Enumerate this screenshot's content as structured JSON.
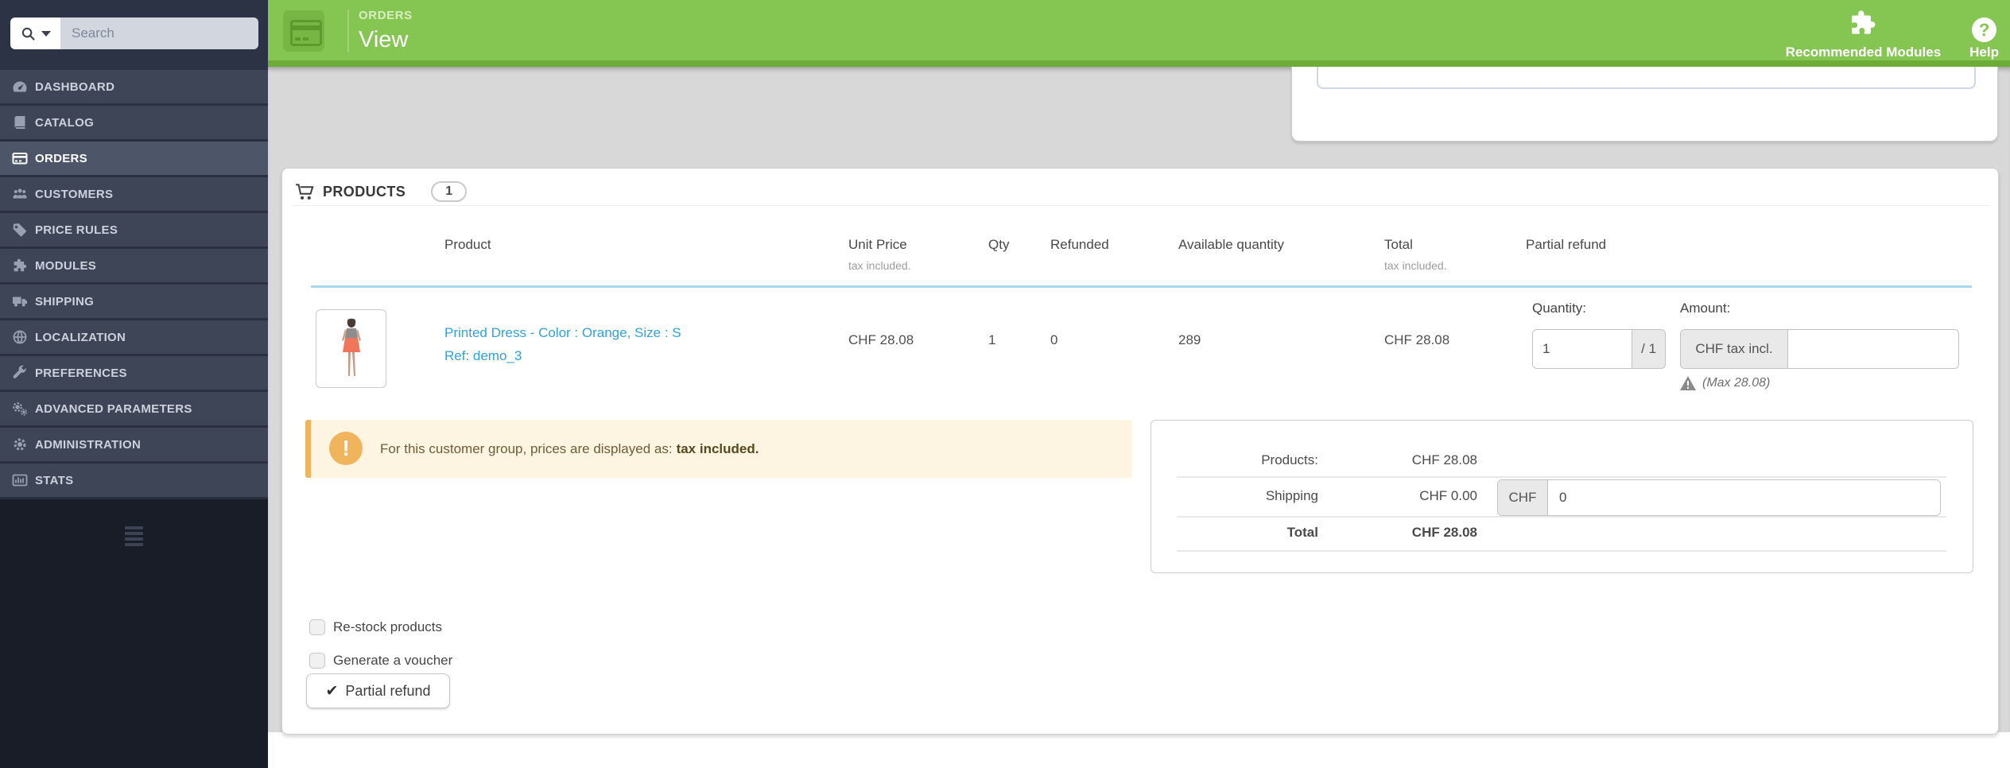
{
  "colors": {
    "accent_green": "#85c551",
    "link_blue": "#2fa3dc",
    "warning_orange": "#f0b45c"
  },
  "sidebar": {
    "search_placeholder": "Search",
    "items": [
      {
        "label": "DASHBOARD"
      },
      {
        "label": "CATALOG"
      },
      {
        "label": "ORDERS"
      },
      {
        "label": "CUSTOMERS"
      },
      {
        "label": "PRICE RULES"
      },
      {
        "label": "MODULES"
      },
      {
        "label": "SHIPPING"
      },
      {
        "label": "LOCALIZATION"
      },
      {
        "label": "PREFERENCES"
      },
      {
        "label": "ADVANCED PARAMETERS"
      },
      {
        "label": "ADMINISTRATION"
      },
      {
        "label": "STATS"
      }
    ]
  },
  "header": {
    "breadcrumb": "ORDERS",
    "title": "View",
    "recommended_modules_label": "Recommended Modules",
    "help_label": "Help",
    "help_glyph": "?"
  },
  "panel": {
    "title": "PRODUCTS",
    "count": "1",
    "columns": {
      "product": "Product",
      "unit_price": "Unit Price",
      "qty": "Qty",
      "refunded": "Refunded",
      "available_quantity": "Available quantity",
      "total": "Total",
      "partial_refund": "Partial refund",
      "tax_note": "tax included."
    },
    "row": {
      "name": "Printed Dress - Color : Orange, Size : S",
      "ref": "Ref: demo_3",
      "unit_price": "CHF 28.08",
      "qty": "1",
      "refunded": "0",
      "available_quantity": "289",
      "total": "CHF 28.08",
      "refund_quantity_label": "Quantity:",
      "refund_quantity_value": "1",
      "refund_quantity_max": "/ 1",
      "refund_amount_label": "Amount:",
      "refund_amount_addon": "CHF tax incl.",
      "refund_amount_value": "",
      "refund_max_note": "(Max 28.08)"
    },
    "notice": {
      "glyph": "!",
      "text": "For this customer group, prices are displayed as: ",
      "bold": "tax included."
    },
    "totals": {
      "products_label": "Products:",
      "products_value": "CHF 28.08",
      "shipping_label": "Shipping",
      "shipping_value": "CHF 0.00",
      "shipping_currency": "CHF",
      "shipping_input_value": "0",
      "total_label": "Total",
      "total_value": "CHF 28.08"
    },
    "options": [
      {
        "label": "Re-stock products"
      },
      {
        "label": "Generate a voucher"
      }
    ],
    "submit": {
      "glyph": "✔",
      "label": "Partial refund"
    }
  }
}
